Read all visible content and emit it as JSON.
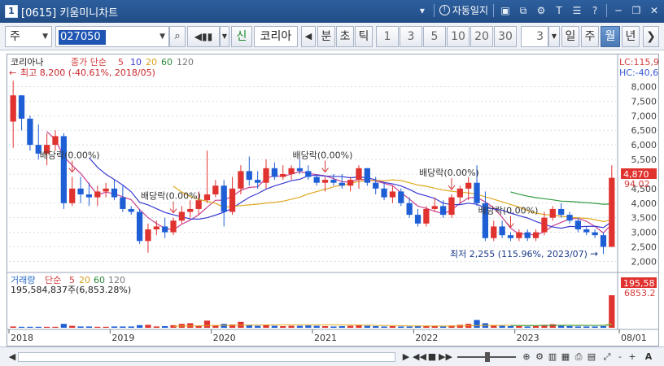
{
  "window": {
    "number": "1",
    "title": "[0615] 키움미니차트",
    "autosave_label": "자동일지",
    "icons": [
      "layout-icon",
      "copy-icon",
      "settings-icon",
      "text-icon",
      "list-icon",
      "help-icon",
      "minimize-icon",
      "restore-icon",
      "close-icon"
    ]
  },
  "toolbar": {
    "market_type": "주",
    "stock_code": "027050",
    "new_label": "신",
    "stock_name": "코리아",
    "period_buttons": [
      "분",
      "초",
      "틱"
    ],
    "interval_buttons": [
      "1",
      "3",
      "5",
      "10",
      "20",
      "30"
    ],
    "interval_value": "3",
    "range_buttons": [
      "일",
      "주",
      "월",
      "년"
    ],
    "selected_range": "월"
  },
  "price_panel": {
    "header_name": "코리아나",
    "header_ma": [
      "종가 단순",
      "5",
      "10",
      "20",
      "60",
      "120"
    ],
    "lc_label": "LC:115,9",
    "hc_label": "HC:-40,6",
    "high_annotation": "최고 8,200 (-40.61%, 2018/05)",
    "low_annotation": "최저 2,255 (115.96%, 2023/07)",
    "current_price": "4,870",
    "current_change": "94.02",
    "dividend_label": "배당락(0.00%)"
  },
  "volume_panel": {
    "header_name": "거래량",
    "header_ma": [
      "단순",
      "5",
      "20",
      "60",
      "120"
    ],
    "summary": "195,584,837주(6,853.28%)",
    "current_volume": "195,58",
    "current_ratio": "6853.2"
  },
  "chart_data": {
    "type": "candlestick",
    "period": "monthly",
    "x": [
      "2018",
      "2019",
      "2020",
      "2021",
      "2022",
      "2023",
      "08/01"
    ],
    "y_ticks": [
      2000,
      2500,
      3000,
      3500,
      4000,
      4500,
      5000,
      5500,
      6000,
      6500,
      7000,
      7500,
      8000
    ],
    "ylim": [
      1900,
      8600
    ],
    "candles": [
      [
        6800,
        8200,
        5900,
        7700
      ],
      [
        7700,
        7700,
        6500,
        6900
      ],
      [
        6900,
        7000,
        5800,
        6000
      ],
      [
        6000,
        6700,
        5500,
        5700
      ],
      [
        5700,
        6400,
        5300,
        6000
      ],
      [
        6000,
        6500,
        5800,
        6300
      ],
      [
        6300,
        6400,
        3800,
        4000
      ],
      [
        4000,
        4900,
        3900,
        4500
      ],
      [
        4500,
        4900,
        4000,
        4300
      ],
      [
        4300,
        4700,
        3900,
        4200
      ],
      [
        4200,
        4600,
        3900,
        4400
      ],
      [
        4400,
        4700,
        4200,
        4500
      ],
      [
        4500,
        4800,
        4100,
        4200
      ],
      [
        4200,
        4600,
        3700,
        3800
      ],
      [
        3800,
        3900,
        3600,
        3700
      ],
      [
        3700,
        3800,
        2600,
        2700
      ],
      [
        2700,
        3300,
        2300,
        3100
      ],
      [
        3100,
        3400,
        2900,
        3200
      ],
      [
        3200,
        3500,
        2800,
        3000
      ],
      [
        3000,
        3500,
        2900,
        3400
      ],
      [
        3400,
        3900,
        3300,
        3700
      ],
      [
        3700,
        4100,
        3500,
        3800
      ],
      [
        3800,
        4400,
        3600,
        4100
      ],
      [
        4100,
        5800,
        4000,
        4300
      ],
      [
        4300,
        4800,
        4200,
        4600
      ],
      [
        4600,
        4800,
        3200,
        3700
      ],
      [
        3700,
        4900,
        3600,
        4500
      ],
      [
        4500,
        5300,
        4300,
        5100
      ],
      [
        5100,
        5600,
        4600,
        4800
      ],
      [
        4800,
        5100,
        4500,
        4700
      ],
      [
        4700,
        5500,
        4500,
        5200
      ],
      [
        5200,
        5400,
        4800,
        4900
      ],
      [
        4900,
        5300,
        4800,
        5000
      ],
      [
        5000,
        5300,
        4800,
        5200
      ],
      [
        5200,
        5500,
        5000,
        5100
      ],
      [
        5100,
        5300,
        4800,
        4900
      ],
      [
        4900,
        5000,
        4600,
        4700
      ],
      [
        4700,
        4900,
        4400,
        4800
      ],
      [
        4800,
        5000,
        4600,
        4700
      ],
      [
        4700,
        5000,
        4500,
        4600
      ],
      [
        4600,
        4900,
        4400,
        4800
      ],
      [
        4800,
        5300,
        4500,
        5200
      ],
      [
        5200,
        5200,
        4600,
        4700
      ],
      [
        4700,
        4900,
        4300,
        4500
      ],
      [
        4500,
        4700,
        4100,
        4200
      ],
      [
        4200,
        4600,
        4000,
        4400
      ],
      [
        4400,
        4500,
        3900,
        4000
      ],
      [
        4000,
        4200,
        3500,
        3600
      ],
      [
        3600,
        3800,
        3200,
        3300
      ],
      [
        3300,
        3900,
        3200,
        3800
      ],
      [
        3800,
        4200,
        3700,
        3900
      ],
      [
        3900,
        4100,
        3500,
        3600
      ],
      [
        3600,
        4300,
        3500,
        4200
      ],
      [
        4200,
        4600,
        4000,
        4500
      ],
      [
        4500,
        4900,
        4100,
        4700
      ],
      [
        4700,
        5300,
        3900,
        4000
      ],
      [
        4000,
        4400,
        2700,
        2800
      ],
      [
        2800,
        3400,
        2700,
        3200
      ],
      [
        3200,
        3400,
        2800,
        2900
      ],
      [
        2900,
        3000,
        2700,
        2800
      ],
      [
        2800,
        3100,
        2700,
        3000
      ],
      [
        3000,
        3100,
        2700,
        2800
      ],
      [
        2800,
        3100,
        2700,
        3000
      ],
      [
        3000,
        3700,
        2900,
        3500
      ],
      [
        3500,
        3900,
        3400,
        3800
      ],
      [
        3800,
        4000,
        3500,
        3600
      ],
      [
        3600,
        3700,
        3300,
        3400
      ],
      [
        3400,
        3500,
        3000,
        3100
      ],
      [
        3100,
        3200,
        2900,
        3000
      ],
      [
        3000,
        3100,
        2800,
        2900
      ],
      [
        2900,
        3000,
        2255,
        2500
      ],
      [
        2500,
        5300,
        2500,
        4870
      ]
    ],
    "volume": [
      4,
      3,
      3,
      3,
      3,
      3,
      12,
      6,
      4,
      4,
      3,
      3,
      4,
      4,
      4,
      8,
      9,
      4,
      5,
      8,
      12,
      14,
      7,
      22,
      7,
      12,
      10,
      18,
      9,
      6,
      8,
      6,
      5,
      6,
      6,
      7,
      6,
      5,
      4,
      5,
      6,
      9,
      6,
      5,
      4,
      5,
      4,
      4,
      5,
      6,
      5,
      4,
      7,
      9,
      12,
      24,
      14,
      8,
      6,
      5,
      5,
      4,
      5,
      9,
      11,
      6,
      5,
      4,
      4,
      4,
      5,
      100
    ],
    "dividend_months": [
      7,
      19,
      37,
      52,
      59
    ]
  },
  "bottom": {
    "buttons": [
      "▶",
      "◀◀",
      "■",
      "▶▶",
      "-",
      "+",
      "A"
    ]
  }
}
